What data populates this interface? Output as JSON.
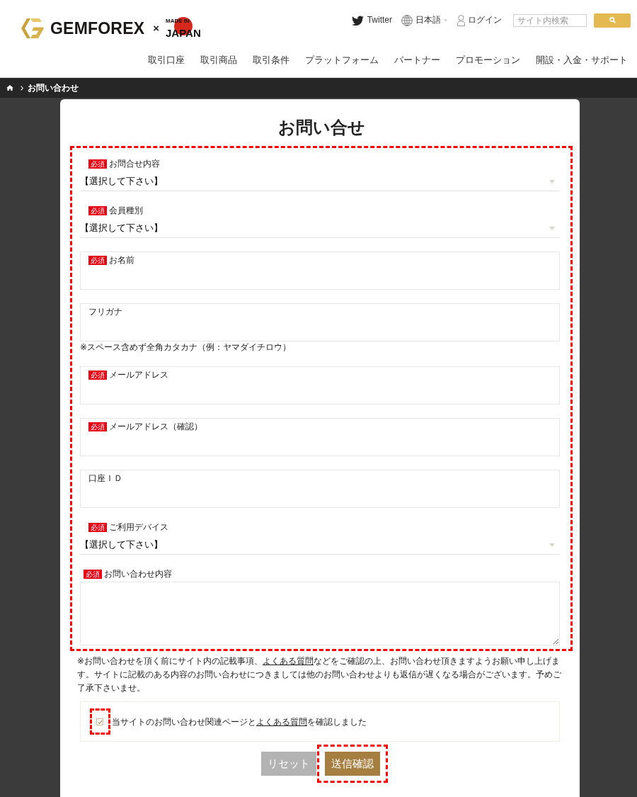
{
  "header": {
    "logo": {
      "brand": "GEMFOREX",
      "separator": "×",
      "badge_top": "MADE IN",
      "badge_main": "JAPAN"
    },
    "links": [
      {
        "kind": "twitter",
        "label": "Twitter"
      },
      {
        "kind": "language",
        "label": "日本語"
      },
      {
        "kind": "login",
        "label": "ログイン"
      }
    ],
    "search": {
      "placeholder": "サイト内検索"
    },
    "nav": [
      "取引口座",
      "取引商品",
      "取引条件",
      "プラットフォーム",
      "パートナー",
      "プロモーション",
      "開設・入金・サポート"
    ]
  },
  "breadcrumb": {
    "current": "お問い合わせ"
  },
  "form": {
    "title": "お問い合せ",
    "highlighted": true,
    "fields": [
      {
        "kind": "select",
        "badge": "必須",
        "label": "お問合せ内容",
        "value": "【選択して下さい】"
      },
      {
        "kind": "select",
        "badge": "必須",
        "label": "会員種別",
        "value": "【選択して下さい】"
      },
      {
        "kind": "text",
        "badge": "必須",
        "label": "お名前"
      },
      {
        "kind": "text",
        "label": "フリガナ",
        "note": "※スペース含めず全角カタカナ（例：ヤマダイチロウ）"
      },
      {
        "kind": "text",
        "badge": "必須",
        "label": "メールアドレス"
      },
      {
        "kind": "text",
        "badge": "必須",
        "label": "メールアドレス（確認）"
      },
      {
        "kind": "text",
        "label": "口座ＩＤ"
      },
      {
        "kind": "select",
        "badge": "必須",
        "label": "ご利用デバイス",
        "value": "【選択して下さい】"
      },
      {
        "kind": "textarea",
        "badge": "必須",
        "label": "お問い合わせ内容"
      }
    ]
  },
  "notice": [
    {
      "kind": "text",
      "text": "※お問い合わせを頂く前にサイト内の記載事項、"
    },
    {
      "kind": "link",
      "text": "よくある質問"
    },
    {
      "kind": "text",
      "text": "などをご確認の上、お問い合わせ頂きますようお願い申し上げます。サイトに記載のある内容のお問い合わせにつきましては他のお問い合わせよりも返信が遅くなる場合がございます。予めご了承下さいませ。"
    }
  ],
  "consent": {
    "checked": true,
    "highlighted": true,
    "parts": [
      {
        "kind": "text",
        "text": "当サイトのお問い合わせ関連ページと"
      },
      {
        "kind": "link",
        "text": "よくある質問"
      },
      {
        "kind": "text",
        "text": "を確認しました"
      }
    ]
  },
  "buttons": [
    {
      "kind": "reset",
      "label": "リセット",
      "highlighted": false
    },
    {
      "kind": "submit",
      "label": "送信確認",
      "highlighted": true
    }
  ]
}
